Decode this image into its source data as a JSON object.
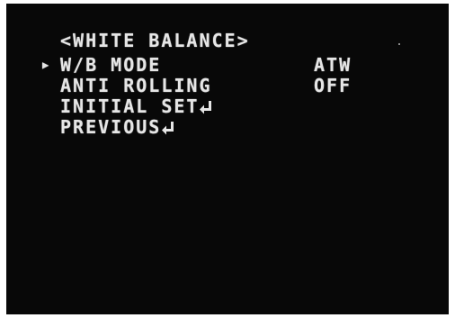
{
  "menu": {
    "title": "<WHITE BALANCE>",
    "cursor_icon": "right-triangle",
    "enter_icon": "return-arrow",
    "items": [
      {
        "label": "W/B MODE",
        "value": "ATW",
        "selected": true
      },
      {
        "label": "ANTI ROLLING",
        "value": "OFF",
        "selected": false
      },
      {
        "label": "INITIAL SET",
        "value": "",
        "selected": false,
        "enter": true
      },
      {
        "label": "PREVIOUS",
        "value": "",
        "selected": false,
        "enter": true
      }
    ]
  },
  "colors": {
    "background": "#080808",
    "text": "#e6e6e6"
  }
}
